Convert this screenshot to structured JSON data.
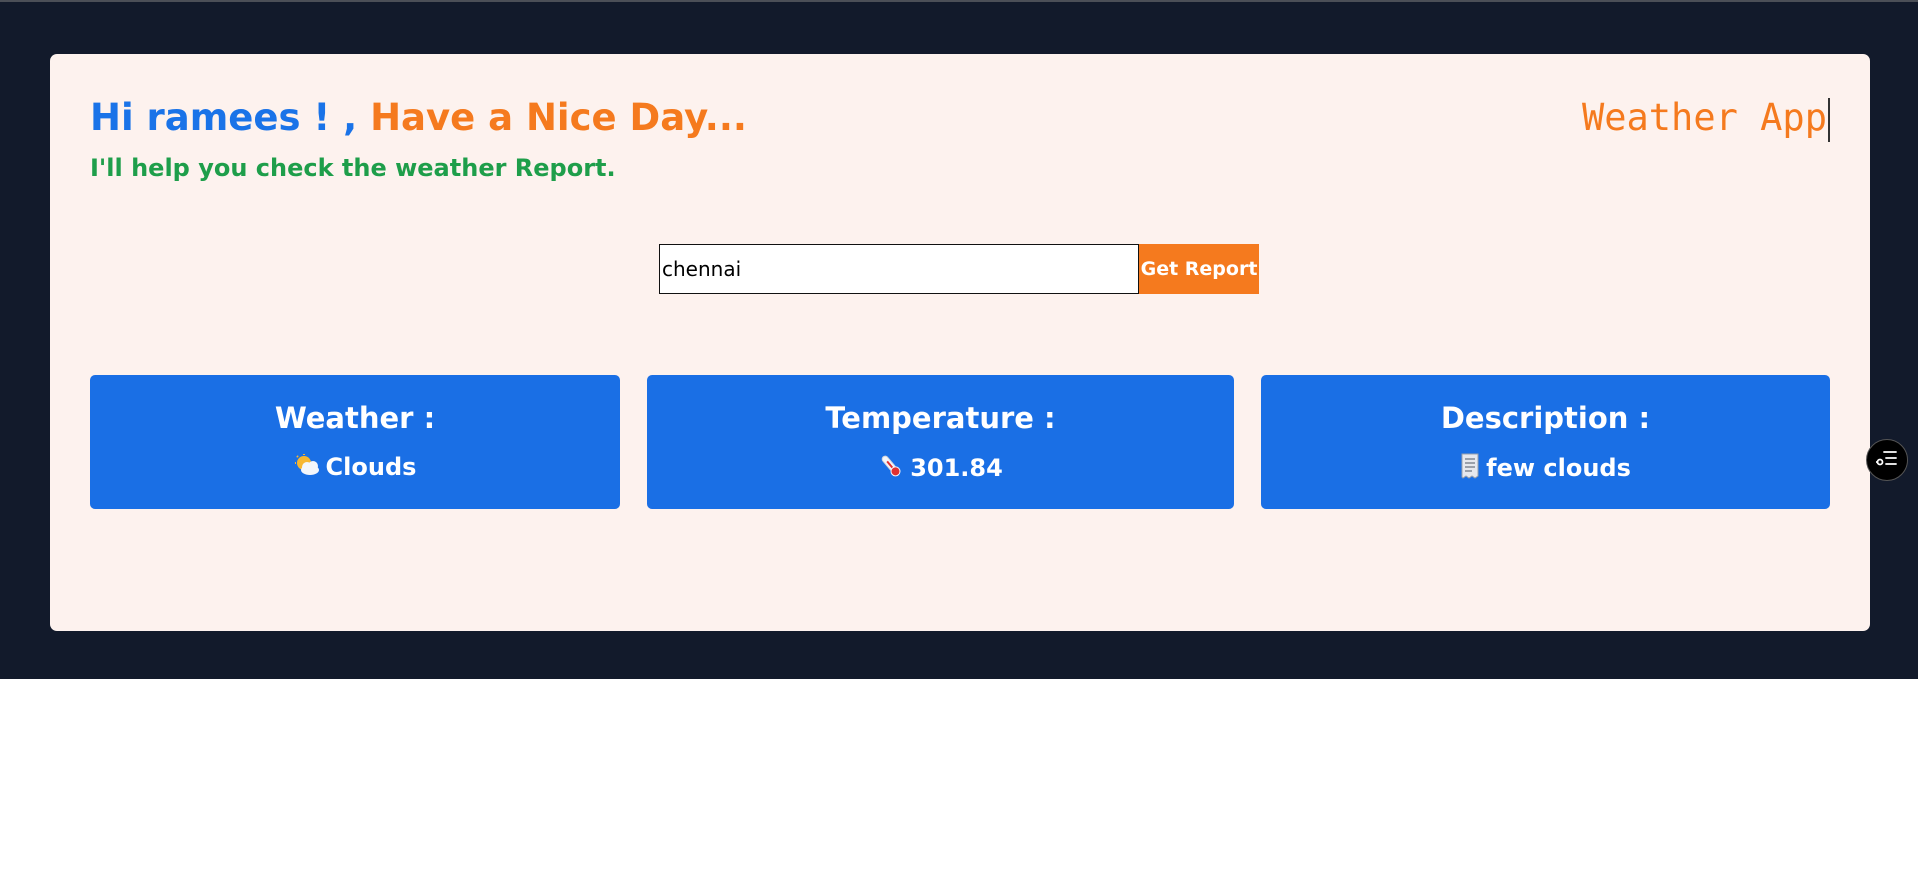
{
  "header": {
    "greeting_hi": "Hi ramees ! ,",
    "greeting_nice": "Have a Nice Day...",
    "subtext": "I'll help you check the weather Report.",
    "app_title": "Weather App"
  },
  "search": {
    "value": "chennai",
    "button_label": "Get Report"
  },
  "cards": {
    "weather": {
      "label": "Weather :",
      "icon": "sun-behind-cloud-icon",
      "value": "Clouds"
    },
    "temperature": {
      "label": "Temperature :",
      "icon": "thermometer-icon",
      "value": "301.84"
    },
    "description": {
      "label": "Description :",
      "icon": "receipt-icon",
      "value": "few clouds"
    }
  },
  "floating_button": {
    "icon": "settings-list-icon"
  },
  "colors": {
    "page_dark": "#121a2b",
    "card_bg": "#fdf2ee",
    "accent_blue": "#1a73e8",
    "accent_orange": "#f57a1e",
    "accent_green": "#1e9e4a",
    "info_box_blue": "#1a6fe5"
  }
}
